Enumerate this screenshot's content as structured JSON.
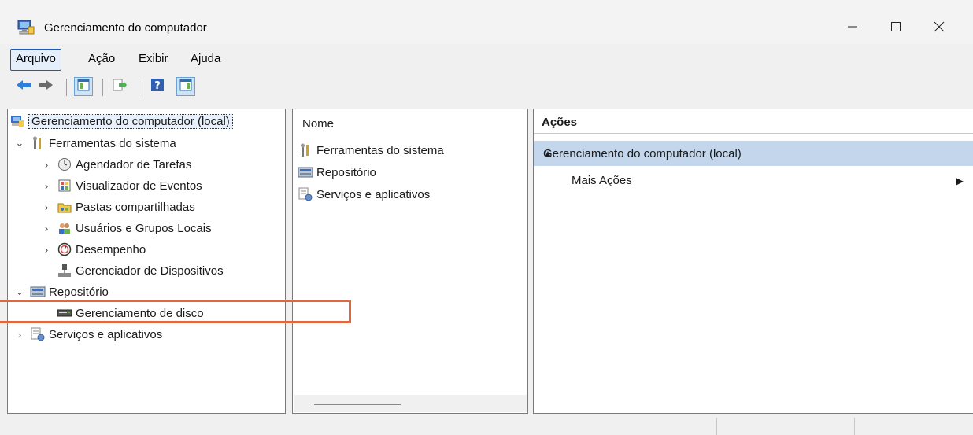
{
  "window": {
    "title": "Gerenciamento do computador",
    "app_icon": "computer-management-icon",
    "controls": [
      "minimize-icon",
      "maximize-icon",
      "close-icon"
    ]
  },
  "menu": {
    "items": [
      "Arquivo",
      "Ação",
      "Exibir",
      "Ajuda"
    ],
    "active": "Arquivo"
  },
  "toolbar": {
    "buttons": [
      "back-arrow-icon",
      "forward-arrow-icon",
      "show-hide-console-tree-icon",
      "export-list-icon",
      "help-icon",
      "show-hide-action-pane-icon"
    ]
  },
  "tree": {
    "root": "Gerenciamento do computador (local)",
    "system_tools": "Ferramentas do sistema",
    "task_scheduler": "Agendador de Tarefas",
    "event_viewer": "Visualizador de Eventos",
    "shared_folders": "Pastas compartilhadas",
    "local_users": "Usuários e Grupos Locais",
    "performance": "Desempenho",
    "device_manager": "Gerenciador de Dispositivos",
    "storage": "Repositório",
    "disk_management": "Gerenciamento de disco",
    "services_apps": "Serviços e aplicativos"
  },
  "middle": {
    "column_header": "Nome",
    "items": [
      "Ferramentas do sistema",
      "Repositório",
      "Serviços e aplicativos"
    ]
  },
  "actions": {
    "header": "Ações",
    "selected": "Gerenciamento do computador (local)",
    "more": "Mais Ações"
  },
  "colors": {
    "highlight_box": "#e0683f",
    "selection": "#c3d6ec",
    "menu_active_border": "#1c5cb8"
  }
}
